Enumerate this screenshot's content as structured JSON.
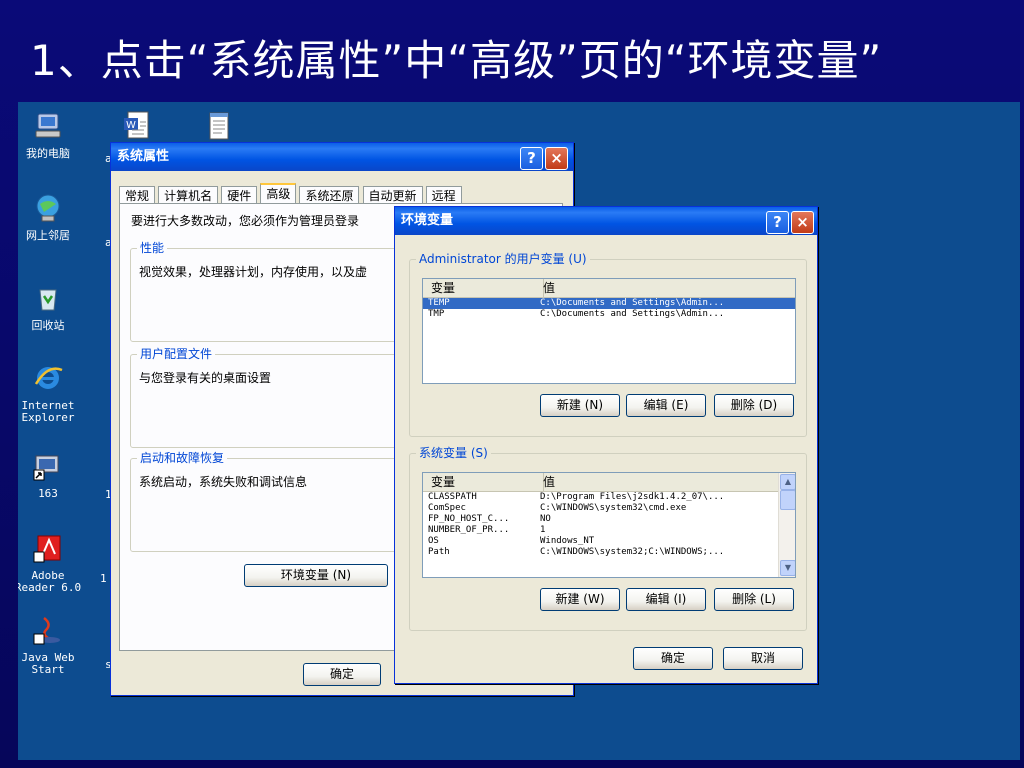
{
  "slide": {
    "title": "1、点击“系统属性”中“高级”页的“环境变量”"
  },
  "desktop": {
    "icons": [
      {
        "label1": "我的电脑",
        "label2": "",
        "icon": "my-computer-icon"
      },
      {
        "label1": "网上邻居",
        "label2": "",
        "icon": "network-places-icon"
      },
      {
        "label1": "回收站",
        "label2": "",
        "icon": "recycle-bin-icon"
      },
      {
        "label1": "Internet",
        "label2": "Explorer",
        "icon": "internet-explorer-icon"
      },
      {
        "label1": "163",
        "label2": "",
        "icon": "shortcut-163-icon"
      },
      {
        "label1": "Adobe",
        "label2": "Reader 6.0",
        "icon": "adobe-reader-icon"
      },
      {
        "label1": "Java Web",
        "label2": "Start",
        "icon": "java-web-start-icon"
      }
    ],
    "clipped_labels": [
      "a",
      "a",
      "1",
      "1",
      "s"
    ]
  },
  "sysprops": {
    "title": "系统属性",
    "help": "?",
    "close": "×",
    "tabs": [
      "常规",
      "计算机名",
      "硬件",
      "高级",
      "系统还原",
      "自动更新",
      "远程"
    ],
    "admin_notice": "要进行大多数改动，您必须作为管理员登录",
    "perf": {
      "label": "性能",
      "text": "视觉效果，处理器计划，内存使用，以及虚"
    },
    "profile": {
      "label": "用户配置文件",
      "text": "与您登录有关的桌面设置"
    },
    "startup": {
      "label": "启动和故障恢复",
      "text": "系统启动，系统失败和调试信息"
    },
    "env_button": "环境变量 (N)",
    "ok_button": "确定"
  },
  "envvars": {
    "title": "环境变量",
    "help": "?",
    "close": "×",
    "user_section": "Administrator 的用户变量 (U)",
    "col_var": "变量",
    "col_val": "值",
    "user_vars": [
      {
        "name": "TEMP",
        "value": "C:\\Documents and Settings\\Admin...",
        "selected": true
      },
      {
        "name": "TMP",
        "value": "C:\\Documents and Settings\\Admin...",
        "selected": false
      }
    ],
    "user_new": "新建 (N)",
    "user_edit": "编辑 (E)",
    "user_delete": "删除 (D)",
    "sys_section": "系统变量 (S)",
    "sys_vars": [
      {
        "name": "CLASSPATH",
        "value": "D:\\Program Files\\j2sdk1.4.2_07\\..."
      },
      {
        "name": "ComSpec",
        "value": "C:\\WINDOWS\\system32\\cmd.exe"
      },
      {
        "name": "FP_NO_HOST_C...",
        "value": "NO"
      },
      {
        "name": "NUMBER_OF_PR...",
        "value": "1"
      },
      {
        "name": "OS",
        "value": "Windows_NT"
      },
      {
        "name": "Path",
        "value": "C:\\WINDOWS\\system32;C:\\WINDOWS;..."
      }
    ],
    "sys_new": "新建 (W)",
    "sys_edit": "编辑 (I)",
    "sys_delete": "删除 (L)",
    "ok_button": "确定",
    "cancel_button": "取消"
  }
}
